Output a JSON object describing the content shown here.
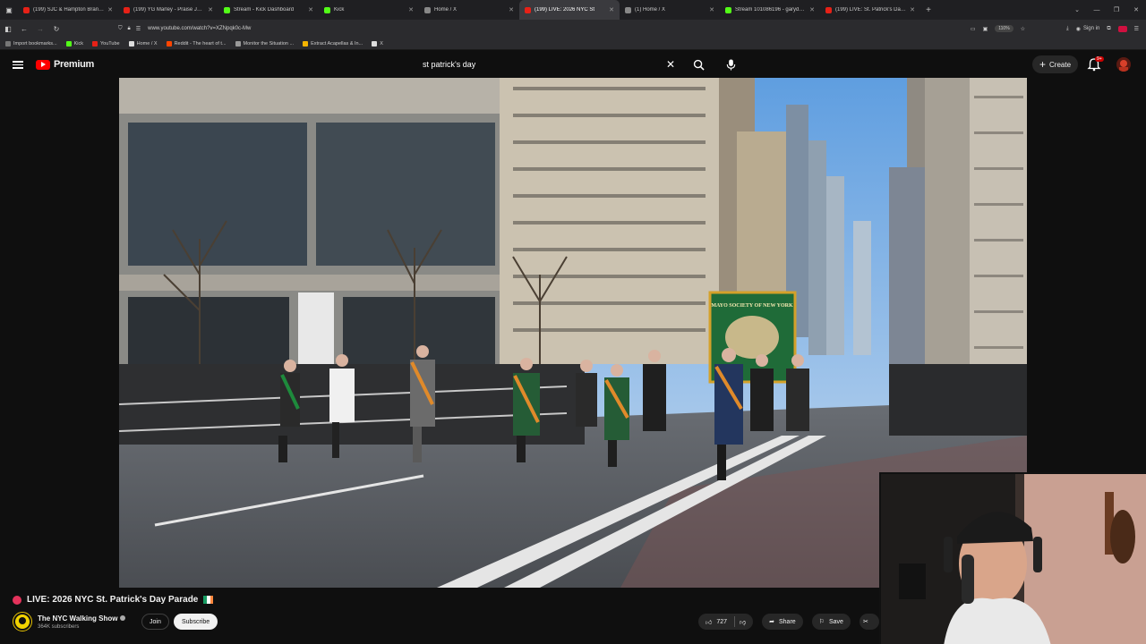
{
  "browser": {
    "tabs": [
      {
        "label": "(199) SJC & Hampton Brandon",
        "fav": "#e62117"
      },
      {
        "label": "(199) YG Marley - Praise Jah In",
        "fav": "#e62117"
      },
      {
        "label": "Stream - Kick Dashboard",
        "fav": "#53fc18"
      },
      {
        "label": "Kick",
        "fav": "#53fc18"
      },
      {
        "label": "Home / X",
        "fav": "#888888"
      },
      {
        "label": "(199) LIVE: 2026 NYC St",
        "fav": "#e62117"
      },
      {
        "label": "(1) Home / X",
        "fav": "#888888"
      },
      {
        "label": "Stream 101086196 - garydavid",
        "fav": "#53fc18"
      },
      {
        "label": "(199) LIVE: St. Patrick's Day para",
        "fav": "#e62117"
      }
    ],
    "url": "www.youtube.com/watch?v=XZNpqk0c-Mw",
    "zoom": "110%",
    "signin": "Sign in",
    "bookmarks": [
      {
        "label": "Import bookmarks...",
        "color": "#777777"
      },
      {
        "label": "Kick",
        "color": "#53fc18"
      },
      {
        "label": "YouTube",
        "color": "#e62117"
      },
      {
        "label": "Home / X",
        "color": "#dddddd"
      },
      {
        "label": "Reddit - The heart of t...",
        "color": "#ff4500"
      },
      {
        "label": "Monitor the Situation ...",
        "color": "#999999"
      },
      {
        "label": "Extract Acapellas & In...",
        "color": "#f5b400"
      },
      {
        "label": "X",
        "color": "#dddddd"
      }
    ]
  },
  "youtube": {
    "logo_text": "Premium",
    "search_query": "st patrick's day",
    "create_label": "Create",
    "notif_badge": "9+",
    "video": {
      "banner_text": "MAYO SOCIETY OF NEW YORK",
      "title": "LIVE: 2026 NYC St. Patrick's Day Parade",
      "channel": "The NYC Walking Show",
      "subscribers": "364K subscribers",
      "join_label": "Join",
      "subscribe_label": "Subscribe",
      "likes": "727",
      "share_label": "Share",
      "save_label": "Save"
    }
  },
  "colors": {
    "accent": "#ff0000",
    "live": "#e4335b"
  }
}
